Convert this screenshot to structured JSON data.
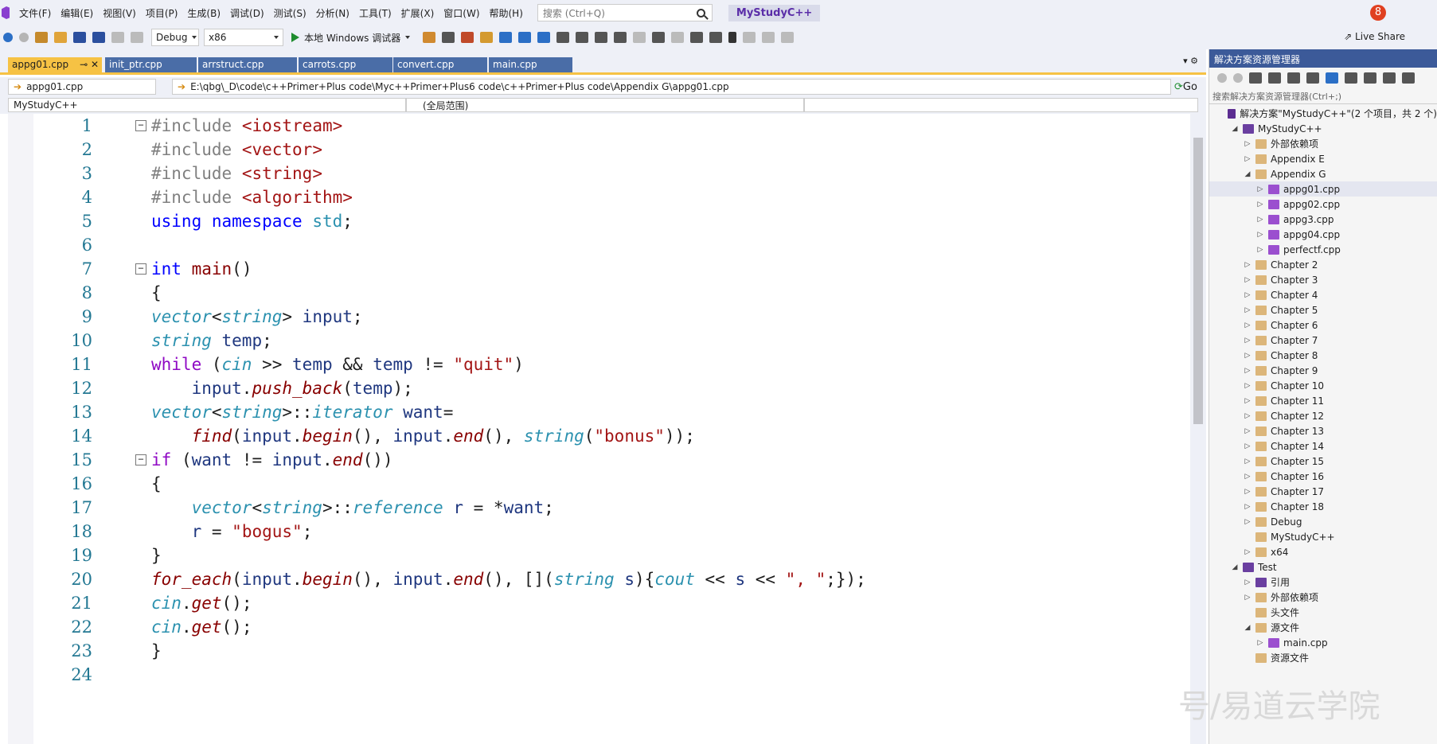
{
  "menu": {
    "items": [
      "文件(F)",
      "编辑(E)",
      "视图(V)",
      "项目(P)",
      "生成(B)",
      "调试(D)",
      "测试(S)",
      "分析(N)",
      "工具(T)",
      "扩展(X)",
      "窗口(W)",
      "帮助(H)"
    ],
    "search_placeholder": "搜索 (Ctrl+Q)",
    "app_title": "MyStudyC++",
    "notification_count": "8"
  },
  "toolbar": {
    "config": "Debug",
    "platform": "x86",
    "run_label": "本地 Windows 调试器",
    "live_share": "Live Share"
  },
  "tabs": [
    "appg01.cpp",
    "init_ptr.cpp",
    "arrstruct.cpp",
    "carrots.cpp",
    "convert.cpp",
    "main.cpp"
  ],
  "pathbar": {
    "file": "appg01.cpp",
    "path": "E:\\qbg\\_D\\code\\c++Primer+Plus code\\Myc++Primer+Plus6 code\\c++Primer+Plus code\\Appendix G\\appg01.cpp",
    "go": "Go"
  },
  "navbar": {
    "project": "MyStudyC++",
    "scope": "(全局范围)"
  },
  "code": {
    "line_numbers": [
      "1",
      "2",
      "3",
      "4",
      "5",
      "6",
      "7",
      "8",
      "9",
      "10",
      "11",
      "12",
      "13",
      "14",
      "15",
      "16",
      "17",
      "18",
      "19",
      "20",
      "21",
      "22",
      "23",
      "24"
    ]
  },
  "solution": {
    "title": "解决方案资源管理器",
    "search_placeholder": "搜索解决方案资源管理器(Ctrl+;)",
    "nodes": [
      {
        "label": "解决方案\"MyStudyC++\"(2 个项目，共 2 个)",
        "level": 0,
        "icon": "solution-icon"
      },
      {
        "label": "MyStudyC++",
        "level": 1,
        "icon": "project-icon",
        "exp": "◢"
      },
      {
        "label": "外部依赖项",
        "level": 2,
        "icon": "folder-icon",
        "exp": "▷"
      },
      {
        "label": "Appendix E",
        "level": 2,
        "icon": "folder-icon",
        "exp": "▷"
      },
      {
        "label": "Appendix G",
        "level": 2,
        "icon": "folder-icon",
        "exp": "◢"
      },
      {
        "label": "appg01.cpp",
        "level": 3,
        "icon": "cpp-file-icon",
        "exp": "▷",
        "sel": true
      },
      {
        "label": "appg02.cpp",
        "level": 3,
        "icon": "cpp-file-icon",
        "exp": "▷"
      },
      {
        "label": "appg3.cpp",
        "level": 3,
        "icon": "cpp-file-icon",
        "exp": "▷"
      },
      {
        "label": "appg04.cpp",
        "level": 3,
        "icon": "cpp-file-icon",
        "exp": "▷"
      },
      {
        "label": "perfectf.cpp",
        "level": 3,
        "icon": "cpp-file-icon",
        "exp": "▷"
      },
      {
        "label": "Chapter 2",
        "level": 2,
        "icon": "folder-icon",
        "exp": "▷"
      },
      {
        "label": "Chapter 3",
        "level": 2,
        "icon": "folder-icon",
        "exp": "▷"
      },
      {
        "label": "Chapter 4",
        "level": 2,
        "icon": "folder-icon",
        "exp": "▷"
      },
      {
        "label": "Chapter 5",
        "level": 2,
        "icon": "folder-icon",
        "exp": "▷"
      },
      {
        "label": "Chapter 6",
        "level": 2,
        "icon": "folder-icon",
        "exp": "▷"
      },
      {
        "label": "Chapter 7",
        "level": 2,
        "icon": "folder-icon",
        "exp": "▷"
      },
      {
        "label": "Chapter 8",
        "level": 2,
        "icon": "folder-icon",
        "exp": "▷"
      },
      {
        "label": "Chapter 9",
        "level": 2,
        "icon": "folder-icon",
        "exp": "▷"
      },
      {
        "label": "Chapter 10",
        "level": 2,
        "icon": "folder-icon",
        "exp": "▷"
      },
      {
        "label": "Chapter 11",
        "level": 2,
        "icon": "folder-icon",
        "exp": "▷"
      },
      {
        "label": "Chapter 12",
        "level": 2,
        "icon": "folder-icon",
        "exp": "▷"
      },
      {
        "label": "Chapter 13",
        "level": 2,
        "icon": "folder-icon",
        "exp": "▷"
      },
      {
        "label": "Chapter 14",
        "level": 2,
        "icon": "folder-icon",
        "exp": "▷"
      },
      {
        "label": "Chapter 15",
        "level": 2,
        "icon": "folder-icon",
        "exp": "▷"
      },
      {
        "label": "Chapter 16",
        "level": 2,
        "icon": "folder-icon",
        "exp": "▷"
      },
      {
        "label": "Chapter 17",
        "level": 2,
        "icon": "folder-icon",
        "exp": "▷"
      },
      {
        "label": "Chapter 18",
        "level": 2,
        "icon": "folder-icon",
        "exp": "▷"
      },
      {
        "label": "Debug",
        "level": 2,
        "icon": "folder-icon",
        "exp": "▷"
      },
      {
        "label": "MyStudyC++",
        "level": 2,
        "icon": "folder-icon",
        "exp": ""
      },
      {
        "label": "x64",
        "level": 2,
        "icon": "folder-icon",
        "exp": "▷"
      },
      {
        "label": "Test",
        "level": 1,
        "icon": "project-icon",
        "exp": "◢"
      },
      {
        "label": "引用",
        "level": 2,
        "icon": "references-icon",
        "exp": "▷"
      },
      {
        "label": "外部依赖项",
        "level": 2,
        "icon": "folder-icon",
        "exp": "▷"
      },
      {
        "label": "头文件",
        "level": 2,
        "icon": "folder-icon",
        "exp": ""
      },
      {
        "label": "源文件",
        "level": 2,
        "icon": "folder-icon",
        "exp": "◢"
      },
      {
        "label": "main.cpp",
        "level": 3,
        "icon": "cpp-file-icon",
        "exp": "▷"
      },
      {
        "label": "资源文件",
        "level": 2,
        "icon": "folder-icon",
        "exp": ""
      }
    ]
  },
  "watermark": "号/易道云学院"
}
